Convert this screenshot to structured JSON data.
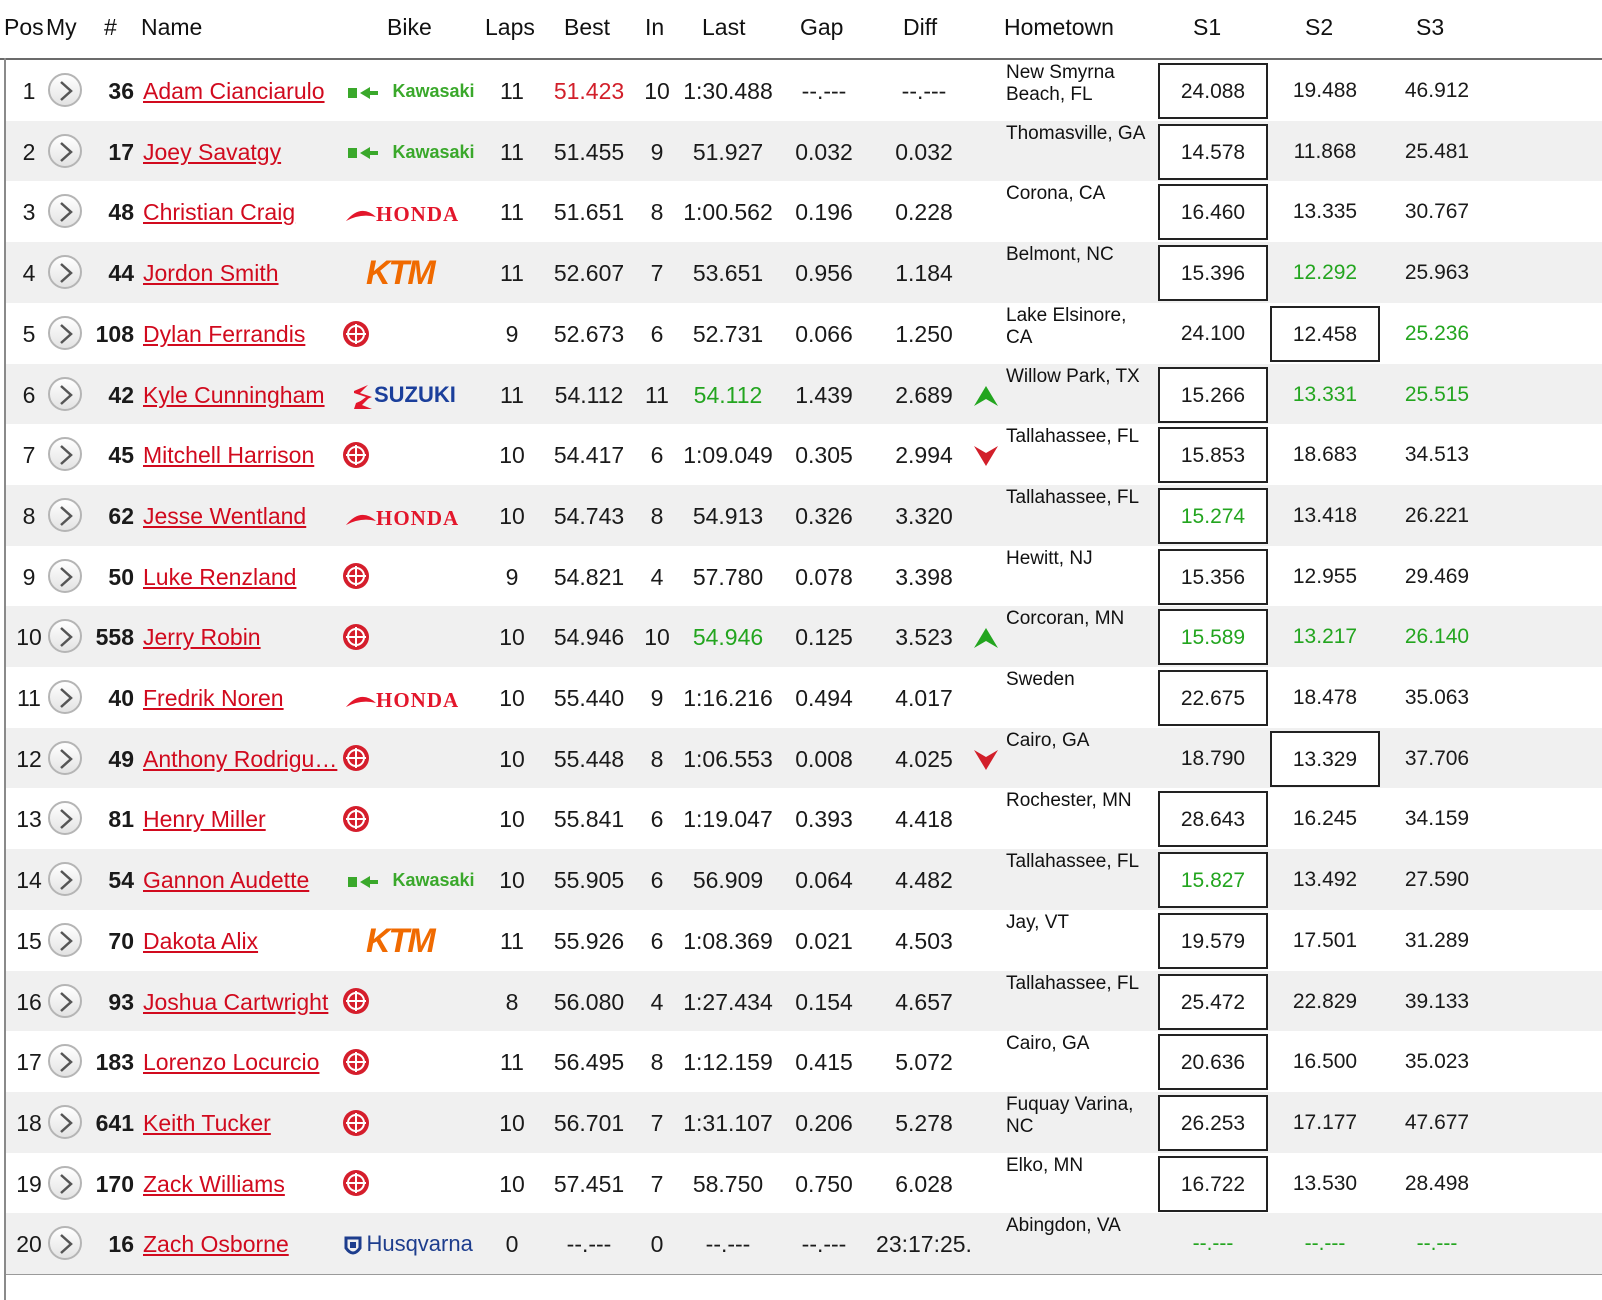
{
  "colors": {
    "name_link": "#d10a1e",
    "best_overall": "#d21f2a",
    "personal_best": "#23a51f",
    "up_arrow": "#23a51f",
    "down_arrow": "#d21f2a"
  },
  "headers": {
    "pos": "Pos",
    "my": "My",
    "num": "#",
    "name": "Name",
    "bike": "Bike",
    "laps": "Laps",
    "best": "Best",
    "in": "In",
    "last": "Last",
    "gap": "Gap",
    "diff": "Diff",
    "hometown": "Hometown",
    "s1": "S1",
    "s2": "S2",
    "s3": "S3"
  },
  "rows": [
    {
      "pos": "1",
      "num": "36",
      "name": "Adam Cianciarulo",
      "bike": "Kawasaki",
      "laps": "11",
      "best": "51.423",
      "best_style": "red",
      "in": "10",
      "last": "1:30.488",
      "last_style": "",
      "gap": "--.---",
      "diff": "--.---",
      "trend": "",
      "hometown": "New Smyrna Beach, FL",
      "s1": "24.088",
      "s1_style": "",
      "s2": "19.488",
      "s2_style": "",
      "s3": "46.912",
      "s3_style": "",
      "boxed": "s1"
    },
    {
      "pos": "2",
      "num": "17",
      "name": "Joey Savatgy",
      "bike": "Kawasaki",
      "laps": "11",
      "best": "51.455",
      "best_style": "",
      "in": "9",
      "last": "51.927",
      "last_style": "",
      "gap": "0.032",
      "diff": "0.032",
      "trend": "",
      "hometown": "Thomasville, GA",
      "s1": "14.578",
      "s1_style": "",
      "s2": "11.868",
      "s2_style": "",
      "s3": "25.481",
      "s3_style": "",
      "boxed": "s1"
    },
    {
      "pos": "3",
      "num": "48",
      "name": "Christian Craig",
      "bike": "Honda",
      "laps": "11",
      "best": "51.651",
      "best_style": "",
      "in": "8",
      "last": "1:00.562",
      "last_style": "",
      "gap": "0.196",
      "diff": "0.228",
      "trend": "",
      "hometown": "Corona, CA",
      "s1": "16.460",
      "s1_style": "",
      "s2": "13.335",
      "s2_style": "",
      "s3": "30.767",
      "s3_style": "",
      "boxed": "s1"
    },
    {
      "pos": "4",
      "num": "44",
      "name": "Jordon Smith",
      "bike": "KTM",
      "laps": "11",
      "best": "52.607",
      "best_style": "",
      "in": "7",
      "last": "53.651",
      "last_style": "",
      "gap": "0.956",
      "diff": "1.184",
      "trend": "",
      "hometown": "Belmont, NC",
      "s1": "15.396",
      "s1_style": "",
      "s2": "12.292",
      "s2_style": "green",
      "s3": "25.963",
      "s3_style": "",
      "boxed": "s1"
    },
    {
      "pos": "5",
      "num": "108",
      "name": "Dylan Ferrandis",
      "bike": "Yamaha",
      "laps": "9",
      "best": "52.673",
      "best_style": "",
      "in": "6",
      "last": "52.731",
      "last_style": "",
      "gap": "0.066",
      "diff": "1.250",
      "trend": "",
      "hometown": "Lake Elsinore, CA",
      "s1": "24.100",
      "s1_style": "",
      "s2": "12.458",
      "s2_style": "",
      "s3": "25.236",
      "s3_style": "green",
      "boxed": "s2"
    },
    {
      "pos": "6",
      "num": "42",
      "name": "Kyle Cunningham",
      "bike": "Suzuki",
      "laps": "11",
      "best": "54.112",
      "best_style": "",
      "in": "11",
      "last": "54.112",
      "last_style": "green",
      "gap": "1.439",
      "diff": "2.689",
      "trend": "up",
      "hometown": "Willow Park, TX",
      "s1": "15.266",
      "s1_style": "",
      "s2": "13.331",
      "s2_style": "green",
      "s3": "25.515",
      "s3_style": "green",
      "boxed": "s1"
    },
    {
      "pos": "7",
      "num": "45",
      "name": "Mitchell Harrison",
      "bike": "Yamaha",
      "laps": "10",
      "best": "54.417",
      "best_style": "",
      "in": "6",
      "last": "1:09.049",
      "last_style": "",
      "gap": "0.305",
      "diff": "2.994",
      "trend": "down",
      "hometown": "Tallahassee, FL",
      "s1": "15.853",
      "s1_style": "",
      "s2": "18.683",
      "s2_style": "",
      "s3": "34.513",
      "s3_style": "",
      "boxed": "s1"
    },
    {
      "pos": "8",
      "num": "62",
      "name": "Jesse Wentland",
      "bike": "Honda",
      "laps": "10",
      "best": "54.743",
      "best_style": "",
      "in": "8",
      "last": "54.913",
      "last_style": "",
      "gap": "0.326",
      "diff": "3.320",
      "trend": "",
      "hometown": "Tallahassee, FL",
      "s1": "15.274",
      "s1_style": "green",
      "s2": "13.418",
      "s2_style": "",
      "s3": "26.221",
      "s3_style": "",
      "boxed": "s1"
    },
    {
      "pos": "9",
      "num": "50",
      "name": "Luke Renzland",
      "bike": "Yamaha",
      "laps": "9",
      "best": "54.821",
      "best_style": "",
      "in": "4",
      "last": "57.780",
      "last_style": "",
      "gap": "0.078",
      "diff": "3.398",
      "trend": "",
      "hometown": "Hewitt, NJ",
      "s1": "15.356",
      "s1_style": "",
      "s2": "12.955",
      "s2_style": "",
      "s3": "29.469",
      "s3_style": "",
      "boxed": "s1"
    },
    {
      "pos": "10",
      "num": "558",
      "name": "Jerry Robin",
      "bike": "Yamaha",
      "laps": "10",
      "best": "54.946",
      "best_style": "",
      "in": "10",
      "last": "54.946",
      "last_style": "green",
      "gap": "0.125",
      "diff": "3.523",
      "trend": "up",
      "hometown": "Corcoran, MN",
      "s1": "15.589",
      "s1_style": "green",
      "s2": "13.217",
      "s2_style": "green",
      "s3": "26.140",
      "s3_style": "green",
      "boxed": "s1"
    },
    {
      "pos": "11",
      "num": "40",
      "name": "Fredrik Noren",
      "bike": "Honda",
      "laps": "10",
      "best": "55.440",
      "best_style": "",
      "in": "9",
      "last": "1:16.216",
      "last_style": "",
      "gap": "0.494",
      "diff": "4.017",
      "trend": "",
      "hometown": "Sweden",
      "s1": "22.675",
      "s1_style": "",
      "s2": "18.478",
      "s2_style": "",
      "s3": "35.063",
      "s3_style": "",
      "boxed": "s1"
    },
    {
      "pos": "12",
      "num": "49",
      "name": "Anthony Rodrigu…",
      "bike": "Yamaha",
      "laps": "10",
      "best": "55.448",
      "best_style": "",
      "in": "8",
      "last": "1:06.553",
      "last_style": "",
      "gap": "0.008",
      "diff": "4.025",
      "trend": "down",
      "hometown": "Cairo, GA",
      "s1": "18.790",
      "s1_style": "",
      "s2": "13.329",
      "s2_style": "",
      "s3": "37.706",
      "s3_style": "",
      "boxed": "s2"
    },
    {
      "pos": "13",
      "num": "81",
      "name": "Henry Miller",
      "bike": "Yamaha",
      "laps": "10",
      "best": "55.841",
      "best_style": "",
      "in": "6",
      "last": "1:19.047",
      "last_style": "",
      "gap": "0.393",
      "diff": "4.418",
      "trend": "",
      "hometown": "Rochester, MN",
      "s1": "28.643",
      "s1_style": "",
      "s2": "16.245",
      "s2_style": "",
      "s3": "34.159",
      "s3_style": "",
      "boxed": "s1"
    },
    {
      "pos": "14",
      "num": "54",
      "name": "Gannon Audette",
      "bike": "Kawasaki",
      "laps": "10",
      "best": "55.905",
      "best_style": "",
      "in": "6",
      "last": "56.909",
      "last_style": "",
      "gap": "0.064",
      "diff": "4.482",
      "trend": "",
      "hometown": "Tallahassee, FL",
      "s1": "15.827",
      "s1_style": "green",
      "s2": "13.492",
      "s2_style": "",
      "s3": "27.590",
      "s3_style": "",
      "boxed": "s1"
    },
    {
      "pos": "15",
      "num": "70",
      "name": "Dakota Alix",
      "bike": "KTM",
      "laps": "11",
      "best": "55.926",
      "best_style": "",
      "in": "6",
      "last": "1:08.369",
      "last_style": "",
      "gap": "0.021",
      "diff": "4.503",
      "trend": "",
      "hometown": "Jay, VT",
      "s1": "19.579",
      "s1_style": "",
      "s2": "17.501",
      "s2_style": "",
      "s3": "31.289",
      "s3_style": "",
      "boxed": "s1"
    },
    {
      "pos": "16",
      "num": "93",
      "name": "Joshua Cartwright",
      "bike": "Yamaha",
      "laps": "8",
      "best": "56.080",
      "best_style": "",
      "in": "4",
      "last": "1:27.434",
      "last_style": "",
      "gap": "0.154",
      "diff": "4.657",
      "trend": "",
      "hometown": "Tallahassee, FL",
      "s1": "25.472",
      "s1_style": "",
      "s2": "22.829",
      "s2_style": "",
      "s3": "39.133",
      "s3_style": "",
      "boxed": "s1"
    },
    {
      "pos": "17",
      "num": "183",
      "name": "Lorenzo Locurcio",
      "bike": "Yamaha",
      "laps": "11",
      "best": "56.495",
      "best_style": "",
      "in": "8",
      "last": "1:12.159",
      "last_style": "",
      "gap": "0.415",
      "diff": "5.072",
      "trend": "",
      "hometown": "Cairo, GA",
      "s1": "20.636",
      "s1_style": "",
      "s2": "16.500",
      "s2_style": "",
      "s3": "35.023",
      "s3_style": "",
      "boxed": "s1"
    },
    {
      "pos": "18",
      "num": "641",
      "name": "Keith Tucker",
      "bike": "Yamaha",
      "laps": "10",
      "best": "56.701",
      "best_style": "",
      "in": "7",
      "last": "1:31.107",
      "last_style": "",
      "gap": "0.206",
      "diff": "5.278",
      "trend": "",
      "hometown": "Fuquay Varina, NC",
      "s1": "26.253",
      "s1_style": "",
      "s2": "17.177",
      "s2_style": "",
      "s3": "47.677",
      "s3_style": "",
      "boxed": "s1"
    },
    {
      "pos": "19",
      "num": "170",
      "name": "Zack Williams",
      "bike": "Yamaha",
      "laps": "10",
      "best": "57.451",
      "best_style": "",
      "in": "7",
      "last": "58.750",
      "last_style": "",
      "gap": "0.750",
      "diff": "6.028",
      "trend": "",
      "hometown": "Elko, MN",
      "s1": "16.722",
      "s1_style": "",
      "s2": "13.530",
      "s2_style": "",
      "s3": "28.498",
      "s3_style": "",
      "boxed": "s1"
    },
    {
      "pos": "20",
      "num": "16",
      "name": "Zach Osborne",
      "bike": "Husqvarna",
      "laps": "0",
      "best": "--.---",
      "best_style": "",
      "in": "0",
      "last": "--.---",
      "last_style": "",
      "gap": "--.---",
      "diff": "23:17:25.",
      "trend": "",
      "hometown": "Abingdon, VA",
      "s1": "--.---",
      "s1_style": "green",
      "s2": "--.---",
      "s2_style": "green",
      "s3": "--.---",
      "s3_style": "green",
      "boxed": ""
    }
  ]
}
